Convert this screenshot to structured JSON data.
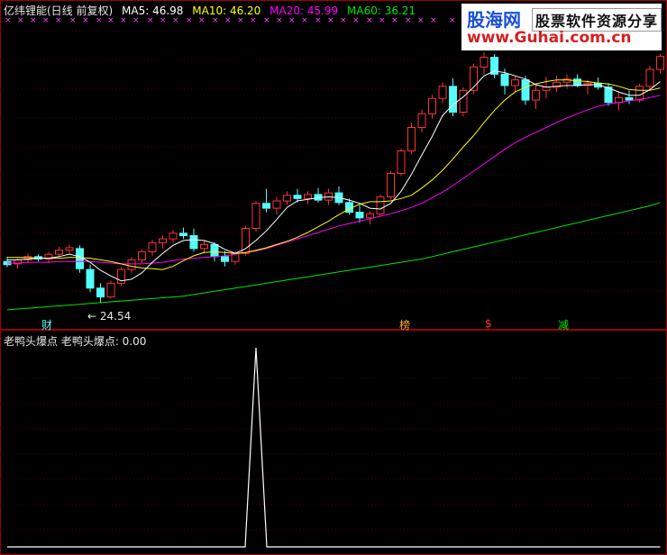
{
  "header": {
    "stock": "亿纬锂能(日线 前复权)",
    "ma5": "MA5: 46.98",
    "ma10": "MA10: 46.20",
    "ma20": "MA20: 45.99",
    "ma60": "MA60: 36.21"
  },
  "sub_header": "老鸭头爆点 老鸭头爆点: 0.00",
  "logo": {
    "site": "股海网",
    "slogan": "股票软件资源分享",
    "url": "www.Guhai.com.cn"
  },
  "events": {
    "cai": "财",
    "bang": "榜",
    "dollar": "$",
    "jian": "减"
  },
  "low_label": "← 24.54",
  "colors": {
    "up": "#ff3232",
    "down": "#54fcfc",
    "ma5": "#ffffff",
    "ma10": "#ffff00",
    "ma20": "#ff00ff",
    "ma60": "#00e600",
    "marker": "#ff44ff"
  },
  "chart_data": [
    {
      "type": "candlestick",
      "ylim": [
        22.7,
        55.3
      ],
      "candles": [
        [
          29.6,
          30.2,
          28.9,
          29.2
        ],
        [
          29.3,
          30.0,
          28.7,
          29.8
        ],
        [
          29.8,
          30.6,
          29.4,
          30.2
        ],
        [
          30.2,
          30.5,
          29.6,
          29.9
        ],
        [
          29.9,
          30.8,
          29.4,
          30.5
        ],
        [
          30.5,
          31.4,
          30.1,
          31.0
        ],
        [
          31.0,
          31.7,
          30.6,
          31.3
        ],
        [
          31.2,
          31.6,
          28.2,
          28.7
        ],
        [
          28.6,
          29.2,
          25.8,
          26.3
        ],
        [
          26.3,
          26.9,
          24.54,
          25.2
        ],
        [
          25.2,
          27.2,
          25.0,
          26.9
        ],
        [
          26.9,
          28.9,
          26.6,
          28.6
        ],
        [
          28.6,
          30.1,
          28.2,
          29.8
        ],
        [
          29.8,
          31.1,
          29.4,
          30.8
        ],
        [
          30.8,
          32.3,
          30.3,
          31.9
        ],
        [
          31.9,
          32.8,
          31.2,
          32.4
        ],
        [
          32.4,
          33.5,
          31.9,
          33.1
        ],
        [
          33.1,
          33.8,
          32.4,
          32.8
        ],
        [
          32.8,
          33.7,
          30.8,
          31.2
        ],
        [
          31.2,
          32.2,
          30.6,
          31.7
        ],
        [
          31.7,
          32.0,
          29.6,
          30.2
        ],
        [
          30.2,
          30.9,
          29.0,
          29.6
        ],
        [
          29.6,
          30.9,
          29.2,
          30.6
        ],
        [
          30.6,
          34.0,
          30.3,
          33.7
        ],
        [
          33.7,
          37.1,
          33.3,
          36.8
        ],
        [
          36.8,
          38.6,
          35.7,
          36.2
        ],
        [
          36.2,
          37.6,
          35.4,
          37.1
        ],
        [
          37.1,
          38.3,
          36.6,
          37.8
        ],
        [
          37.8,
          38.6,
          36.9,
          37.4
        ],
        [
          37.4,
          38.3,
          36.7,
          37.9
        ],
        [
          37.9,
          38.7,
          36.9,
          37.2
        ],
        [
          37.2,
          38.6,
          36.6,
          38.1
        ],
        [
          38.1,
          38.9,
          36.6,
          36.9
        ],
        [
          36.9,
          37.4,
          35.4,
          35.7
        ],
        [
          35.7,
          36.6,
          34.4,
          35.0
        ],
        [
          35.0,
          35.8,
          34.2,
          35.5
        ],
        [
          35.5,
          37.9,
          35.2,
          37.6
        ],
        [
          37.6,
          40.8,
          37.3,
          40.5
        ],
        [
          40.5,
          43.6,
          40.2,
          43.3
        ],
        [
          43.3,
          46.8,
          42.9,
          46.2
        ],
        [
          46.2,
          48.4,
          45.6,
          47.9
        ],
        [
          47.9,
          50.2,
          47.3,
          49.8
        ],
        [
          49.8,
          51.8,
          49.2,
          51.3
        ],
        [
          51.3,
          52.3,
          47.6,
          48.1
        ],
        [
          48.1,
          51.2,
          47.6,
          50.8
        ],
        [
          50.8,
          54.1,
          50.3,
          53.7
        ],
        [
          53.7,
          55.5,
          52.8,
          54.9
        ],
        [
          54.9,
          55.3,
          52.3,
          52.8
        ],
        [
          52.8,
          53.5,
          50.3,
          51.4
        ],
        [
          51.4,
          52.6,
          50.6,
          52.1
        ],
        [
          52.1,
          52.6,
          49.0,
          49.6
        ],
        [
          49.6,
          51.5,
          48.5,
          50.8
        ],
        [
          50.8,
          52.5,
          49.8,
          51.2
        ],
        [
          51.2,
          52.6,
          50.6,
          51.8
        ],
        [
          51.8,
          52.8,
          51.0,
          52.2
        ],
        [
          52.2,
          52.8,
          51.2,
          51.4
        ],
        [
          51.4,
          52.1,
          50.3,
          51.7
        ],
        [
          51.7,
          52.4,
          50.9,
          51.2
        ],
        [
          51.2,
          51.7,
          48.9,
          49.3
        ],
        [
          49.3,
          50.6,
          48.3,
          49.9
        ],
        [
          49.9,
          50.8,
          49.1,
          49.6
        ],
        [
          49.6,
          51.6,
          49.3,
          51.3
        ],
        [
          51.3,
          53.8,
          51.0,
          53.4
        ],
        [
          53.4,
          55.3,
          52.9,
          55.0
        ]
      ],
      "ma5": [
        29.8,
        29.8,
        29.9,
        30.0,
        30.0,
        30.2,
        30.5,
        30.2,
        29.5,
        28.5,
        27.8,
        27.2,
        27.4,
        28.2,
        29.5,
        30.6,
        31.6,
        32.2,
        32.3,
        32.2,
        31.8,
        31.1,
        30.6,
        31.2,
        32.2,
        33.4,
        34.8,
        36.3,
        37.1,
        37.3,
        37.5,
        37.6,
        37.5,
        37.2,
        36.8,
        36.2,
        36.1,
        36.8,
        38.3,
        40.4,
        42.8,
        45.1,
        47.7,
        49.0,
        50.0,
        51.2,
        52.6,
        53.2,
        53.0,
        52.6,
        52.2,
        51.5,
        51.2,
        51.3,
        51.4,
        51.4,
        51.5,
        51.5,
        51.1,
        50.6,
        50.2,
        50.2,
        50.9,
        51.9
      ],
      "ma10": [
        30.1,
        30.1,
        30.1,
        30.0,
        30.0,
        30.0,
        30.1,
        30.1,
        30.0,
        29.8,
        29.6,
        29.3,
        29.0,
        28.8,
        28.7,
        28.6,
        29.0,
        29.7,
        30.3,
        30.7,
        30.8,
        30.7,
        30.6,
        30.7,
        31.0,
        31.3,
        31.7,
        32.1,
        32.6,
        33.2,
        33.9,
        34.6,
        35.4,
        36.1,
        36.7,
        37.0,
        37.0,
        37.1,
        37.4,
        37.8,
        38.7,
        39.7,
        40.9,
        42.3,
        43.8,
        45.2,
        46.8,
        48.3,
        49.6,
        50.6,
        51.2,
        51.6,
        51.9,
        52.1,
        52.1,
        52.0,
        51.9,
        51.7,
        51.6,
        51.3,
        50.9,
        50.8,
        50.8,
        51.1
      ],
      "ma20": [
        29.4,
        29.4,
        29.5,
        29.5,
        29.5,
        29.6,
        29.6,
        29.6,
        29.6,
        29.5,
        29.4,
        29.3,
        29.3,
        29.3,
        29.4,
        29.5,
        29.7,
        29.9,
        30.0,
        30.1,
        30.2,
        30.3,
        30.5,
        30.7,
        30.9,
        31.2,
        31.6,
        32.0,
        32.4,
        32.8,
        33.2,
        33.6,
        34.0,
        34.3,
        34.6,
        34.9,
        35.2,
        35.5,
        35.9,
        36.3,
        36.8,
        37.5,
        38.2,
        39.0,
        39.9,
        40.8,
        41.7,
        42.6,
        43.5,
        44.3,
        45.0,
        45.6,
        46.2,
        46.8,
        47.4,
        47.9,
        48.4,
        48.8,
        49.1,
        49.3,
        49.5,
        49.7,
        49.9,
        50.2
      ],
      "ma60": [
        23.6,
        23.7,
        23.8,
        23.9,
        24.0,
        24.1,
        24.2,
        24.3,
        24.4,
        24.5,
        24.6,
        24.7,
        24.8,
        24.9,
        25.0,
        25.1,
        25.2,
        25.3,
        25.5,
        25.7,
        25.9,
        26.1,
        26.3,
        26.5,
        26.7,
        26.9,
        27.1,
        27.3,
        27.5,
        27.7,
        27.9,
        28.1,
        28.3,
        28.5,
        28.7,
        28.9,
        29.1,
        29.3,
        29.5,
        29.7,
        29.9,
        30.2,
        30.5,
        30.8,
        31.1,
        31.4,
        31.7,
        32.0,
        32.3,
        32.6,
        32.9,
        33.2,
        33.5,
        33.8,
        34.1,
        34.4,
        34.7,
        35.0,
        35.3,
        35.6,
        35.9,
        36.2,
        36.5,
        36.9
      ]
    },
    {
      "type": "line",
      "ylim": [
        0,
        1
      ],
      "values": [
        0,
        0,
        0,
        0,
        0,
        0,
        0,
        0,
        0,
        0,
        0,
        0,
        0,
        0,
        0,
        0,
        0,
        0,
        0,
        0,
        0,
        0,
        0,
        0,
        0,
        0,
        0,
        0,
        0,
        0,
        0,
        0,
        0,
        0,
        0,
        0,
        0,
        0,
        0,
        0,
        0,
        0,
        0,
        0,
        0,
        0,
        0,
        0,
        0,
        0,
        0,
        0,
        0,
        0,
        0,
        0,
        0,
        0,
        0,
        0,
        0,
        0,
        0,
        0
      ],
      "peak": {
        "index": 24,
        "value": 1
      }
    }
  ]
}
